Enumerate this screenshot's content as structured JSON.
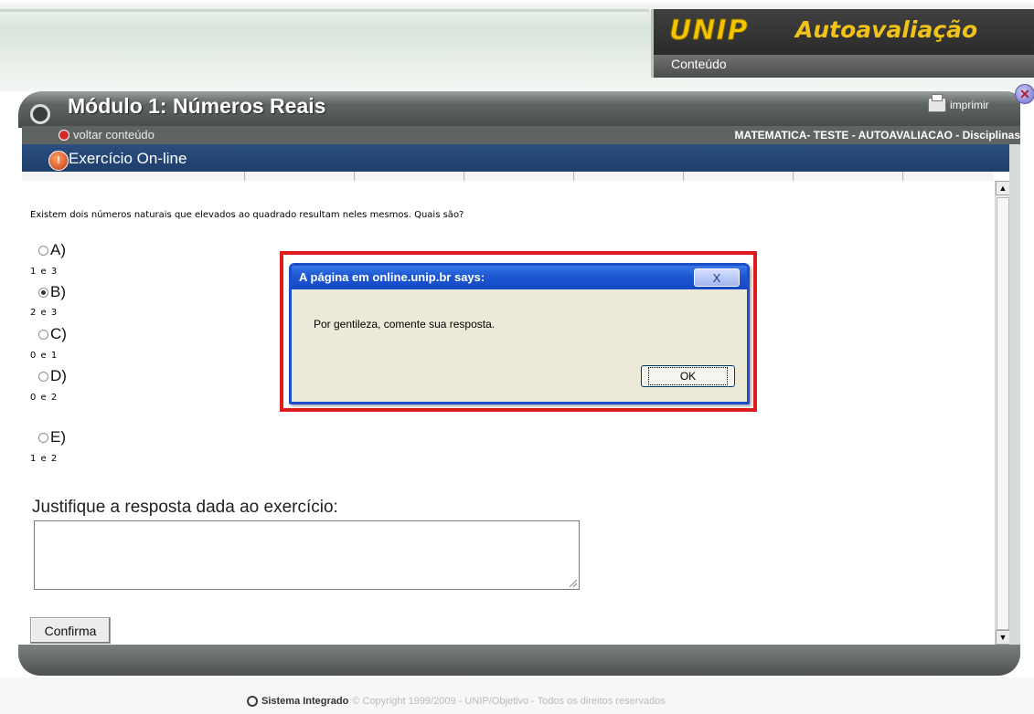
{
  "header": {
    "brand_logo": "UNIP",
    "brand_title": "Autoavaliação",
    "conteudo": "Conteúdo"
  },
  "module": {
    "title": "Módulo 1: Números Reais",
    "print_label": "imprimir",
    "back_label": "voltar conteúdo",
    "breadcrumb": "MATEMATICA- TESTE - AUTOAVALIACAO - Disciplinas",
    "exercise_title": "Exercício On-line"
  },
  "question": {
    "text": "Existem dois números naturais que elevados ao quadrado resultam neles mesmos. Quais são?",
    "options": [
      {
        "label": "A)",
        "answer": "1 e 3",
        "selected": false
      },
      {
        "label": "B)",
        "answer": "2 e 3",
        "selected": true
      },
      {
        "label": "C)",
        "answer": "0 e 1",
        "selected": false
      },
      {
        "label": "D)",
        "answer": "0 e 2",
        "selected": false
      },
      {
        "label": "E)",
        "answer": "1 e 2",
        "selected": false
      }
    ],
    "justify_label": "Justifique a resposta dada ao exercício:",
    "justify_value": "",
    "confirm_label": "Confirma"
  },
  "dialog": {
    "title": "A página em online.unip.br says:",
    "close": "X",
    "message": "Por gentileza, comente sua resposta.",
    "ok": "OK"
  },
  "footer": {
    "brand": "Sistema Integrado",
    "copyright": "© Copyright 1999/2009 - UNIP/Objetivo - Todos os direitos reservados"
  },
  "colors": {
    "accent_blue": "#1d59d3",
    "highlight_red": "#e01b1b",
    "brand_yellow": "#f5c400"
  }
}
